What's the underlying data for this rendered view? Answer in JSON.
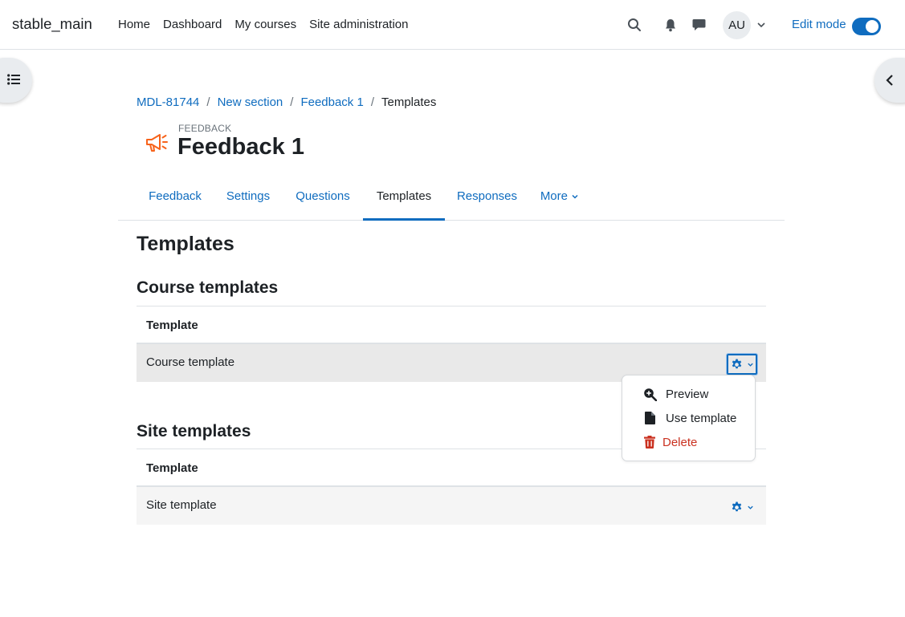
{
  "navbar": {
    "brand": "stable_main",
    "primary_nav": [
      "Home",
      "Dashboard",
      "My courses",
      "Site administration"
    ],
    "avatar_initials": "AU",
    "edit_mode_label": "Edit mode",
    "edit_mode_on": true
  },
  "breadcrumb": {
    "items": [
      "MDL-81744",
      "New section",
      "Feedback 1"
    ],
    "current": "Templates"
  },
  "activity": {
    "kind": "FEEDBACK",
    "title": "Feedback 1",
    "icon": "megaphone-icon"
  },
  "tabs": [
    {
      "label": "Feedback"
    },
    {
      "label": "Settings"
    },
    {
      "label": "Questions"
    },
    {
      "label": "Templates",
      "active": true
    },
    {
      "label": "Responses"
    },
    {
      "label": "More"
    }
  ],
  "page": {
    "heading": "Templates",
    "course_section": {
      "heading": "Course templates",
      "column_header": "Template",
      "rows": [
        "Course template"
      ]
    },
    "site_section": {
      "heading": "Site templates",
      "column_header": "Template",
      "rows": [
        "Site template"
      ]
    }
  },
  "action_menu": {
    "items": [
      {
        "label": "Preview",
        "icon": "zoom-in-icon"
      },
      {
        "label": "Use template",
        "icon": "file-icon"
      },
      {
        "label": "Delete",
        "icon": "trash-icon"
      }
    ]
  },
  "colors": {
    "link": "#0f6cbf",
    "text": "#1d2125",
    "danger": "#ca3120",
    "activity_icon": "#f7631b"
  }
}
